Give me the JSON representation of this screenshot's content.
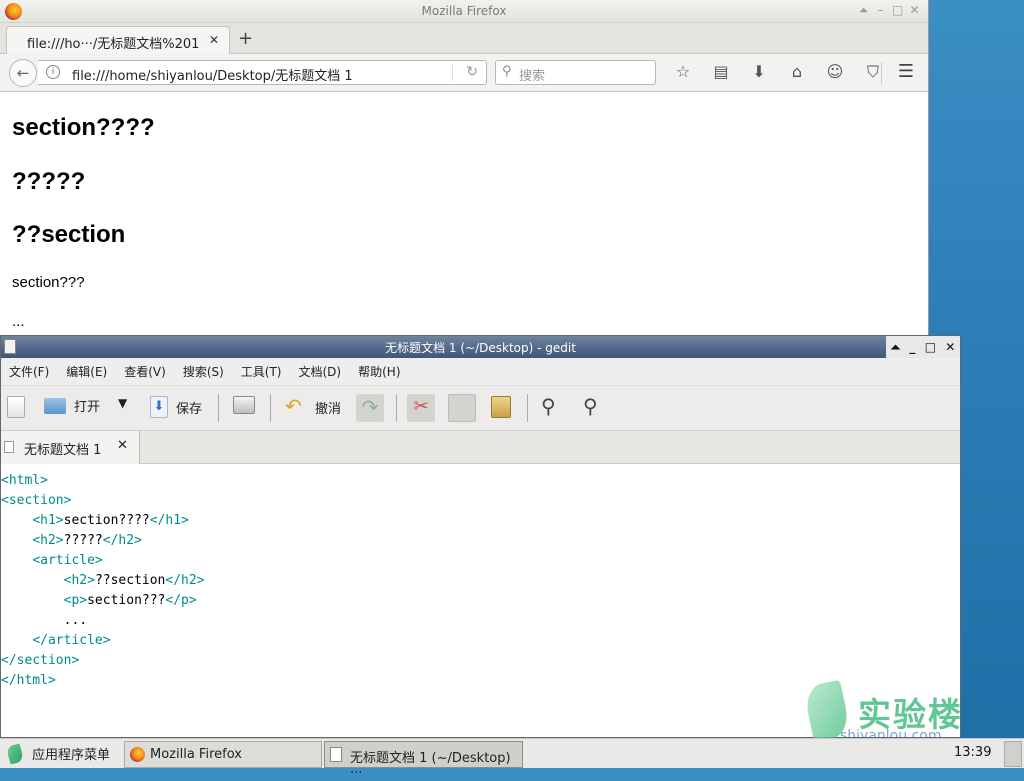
{
  "firefox": {
    "window_title": "Mozilla Firefox",
    "tab_label": "file:///ho···/无标题文档%201",
    "url": "file:///home/shiyanlou/Desktop/无标题文档 1",
    "search_placeholder": "搜索",
    "content": {
      "h1": "section????",
      "h2_a": "?????",
      "h2_b": "??section",
      "p": "section???",
      "dots": "..."
    }
  },
  "gedit": {
    "window_title": "无标题文档 1 (~/Desktop) - gedit",
    "menu": [
      "文件(F)",
      "编辑(E)",
      "查看(V)",
      "搜索(S)",
      "工具(T)",
      "文档(D)",
      "帮助(H)"
    ],
    "toolbar": {
      "open_label": "打开",
      "save_label": "保存",
      "undo_label": "撤消"
    },
    "tab_label": "无标题文档 1",
    "code_lines": [
      {
        "indent": "",
        "open": "<html>",
        "text": "",
        "close": ""
      },
      {
        "indent": "",
        "open": "<section>",
        "text": "",
        "close": ""
      },
      {
        "indent": "    ",
        "open": "<h1>",
        "text": "section????",
        "close": "</h1>"
      },
      {
        "indent": "    ",
        "open": "<h2>",
        "text": "?????",
        "close": "</h2>"
      },
      {
        "indent": "    ",
        "open": "<article>",
        "text": "",
        "close": ""
      },
      {
        "indent": "        ",
        "open": "<h2>",
        "text": "??section",
        "close": "</h2>"
      },
      {
        "indent": "        ",
        "open": "<p>",
        "text": "section???",
        "close": "</p>"
      },
      {
        "indent": "        ",
        "open": "",
        "text": "...",
        "close": ""
      },
      {
        "indent": "    ",
        "open": "</article>",
        "text": "",
        "close": ""
      },
      {
        "indent": "",
        "open": "</section>",
        "text": "",
        "close": ""
      },
      {
        "indent": "",
        "open": "</html>",
        "text": "",
        "close": ""
      }
    ]
  },
  "watermark": {
    "brand": "实验楼",
    "url": "shiyanlou.com"
  },
  "taskbar": {
    "start_label": "应用程序菜单",
    "tasks": [
      "Mozilla Firefox",
      "无标题文档 1 (~/Desktop) ···"
    ],
    "clock": "13:39"
  }
}
